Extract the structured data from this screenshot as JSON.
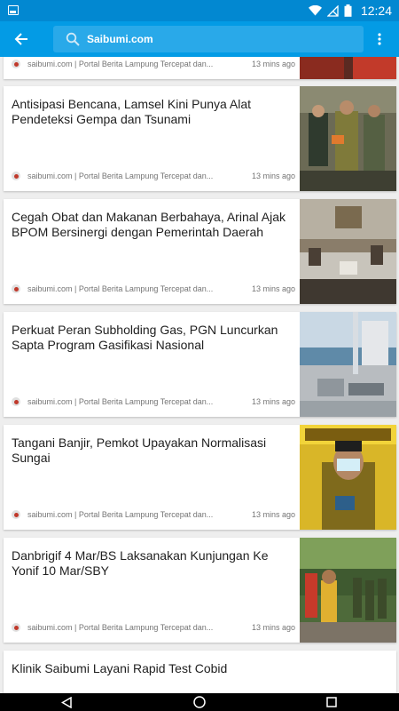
{
  "status": {
    "time": "12:24",
    "icons": [
      "notification-icon",
      "wifi-icon",
      "signal-off-icon",
      "battery-icon"
    ]
  },
  "app_bar": {
    "search_text": "Saibumi.com",
    "icons": [
      "back-arrow-icon",
      "search-icon",
      "more-vert-icon"
    ]
  },
  "feed": {
    "partial_top": {
      "source": "saibumi.com | Portal Berita  Lampung Tercepat dan...",
      "time": "13 mins ago"
    },
    "articles": [
      {
        "title": "Antisipasi Bencana, Lamsel Kini Punya Alat Pendeteksi Gempa dan Tsunami",
        "source": "saibumi.com | Portal Berita  Lampung Tercepat dan...",
        "time": "13 mins ago"
      },
      {
        "title": "Cegah Obat dan Makanan Berbahaya, Arinal Ajak BPOM Bersinergi dengan Pemerintah Daerah",
        "source": "saibumi.com | Portal Berita  Lampung Tercepat dan...",
        "time": "13 mins ago"
      },
      {
        "title": "Perkuat Peran Subholding Gas, PGN Luncurkan Sapta Program Gasifikasi Nasional",
        "source": "saibumi.com | Portal Berita  Lampung Tercepat dan...",
        "time": "13 mins ago"
      },
      {
        "title": "Tangani Banjir, Pemkot Upayakan Normalisasi Sungai",
        "source": "saibumi.com | Portal Berita  Lampung Tercepat dan...",
        "time": "13 mins ago"
      },
      {
        "title": "Danbrigif 4 Mar/BS Laksanakan Kunjungan Ke Yonif 10 Mar/SBY",
        "source": "saibumi.com | Portal Berita  Lampung Tercepat dan...",
        "time": "13 mins ago"
      },
      {
        "title": "Klinik Saibumi Layani Rapid Test Cobid"
      }
    ]
  },
  "nav": {
    "icons": [
      "back-triangle-icon",
      "home-circle-icon",
      "recents-square-icon"
    ]
  },
  "colors": {
    "status_bar": "#0288d1",
    "app_bar": "#039be5",
    "search_field": "#29a9e9",
    "background": "#eeeeee"
  }
}
